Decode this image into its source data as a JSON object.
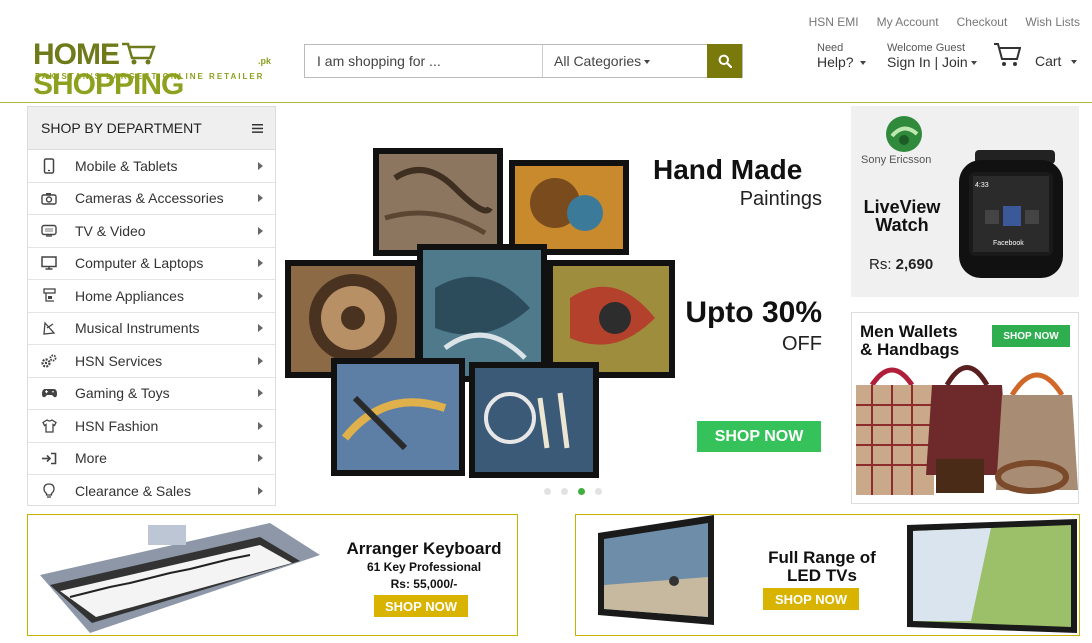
{
  "header": {
    "logo_text_a": "HOME",
    "logo_text_b": "SHOPPING",
    "logo_suffix": ".pk",
    "tagline": "PAKISTAN'S LARGEST ONLINE RETAILER",
    "top_links": [
      "HSN EMI",
      "My Account",
      "Checkout",
      "Wish Lists"
    ],
    "search": {
      "placeholder": "I am shopping for ...",
      "category": "All Categories"
    },
    "help": {
      "small": "Need",
      "big": "Help?"
    },
    "account": {
      "small": "Welcome Guest",
      "big": "Sign In | Join"
    },
    "cart_label": "Cart"
  },
  "sidebar": {
    "title": "SHOP BY DEPARTMENT",
    "items": [
      {
        "label": "Mobile & Tablets",
        "icon": "mobile-icon"
      },
      {
        "label": "Cameras & Accessories",
        "icon": "camera-icon"
      },
      {
        "label": "TV & Video",
        "icon": "tv-icon"
      },
      {
        "label": "Computer & Laptops",
        "icon": "monitor-icon"
      },
      {
        "label": "Home Appliances",
        "icon": "appliance-icon"
      },
      {
        "label": "Musical Instruments",
        "icon": "music-icon"
      },
      {
        "label": "HSN Services",
        "icon": "gears-icon"
      },
      {
        "label": "Gaming & Toys",
        "icon": "gamepad-icon"
      },
      {
        "label": "HSN Fashion",
        "icon": "shirt-icon"
      },
      {
        "label": "More",
        "icon": "sign-in-icon"
      },
      {
        "label": "Clearance & Sales",
        "icon": "lightbulb-icon"
      }
    ]
  },
  "hero": {
    "title": "Hand Made",
    "subtitle": "Paintings",
    "offer_big": "Upto 30%",
    "offer_small": "OFF",
    "button": "SHOP NOW",
    "dot_count": 4,
    "active_dot": 3
  },
  "promo_watch": {
    "brand": "Sony Ericsson",
    "title_line1": "LiveView",
    "title_line2": "Watch",
    "price_prefix": "Rs:",
    "price": "2,690",
    "screen_time": "4:33",
    "screen_app": "Facebook"
  },
  "promo_wallets": {
    "title_line1": "Men Wallets",
    "title_line2": "& Handbags",
    "button": "SHOP NOW"
  },
  "banner_keyboard": {
    "title": "Arranger Keyboard",
    "subtitle": "61 Key Professional",
    "price": "Rs: 55,000/-",
    "button": "SHOP NOW"
  },
  "banner_tv": {
    "title_line1": "Full Range of",
    "title_line2": "LED TVs",
    "button": "SHOP NOW"
  },
  "colors": {
    "brand": "#8ea11f",
    "search_button": "#7a7a0c",
    "hero_button": "#35c25a",
    "banner_button": "#d8b400",
    "banner_border": "#c8b200"
  }
}
